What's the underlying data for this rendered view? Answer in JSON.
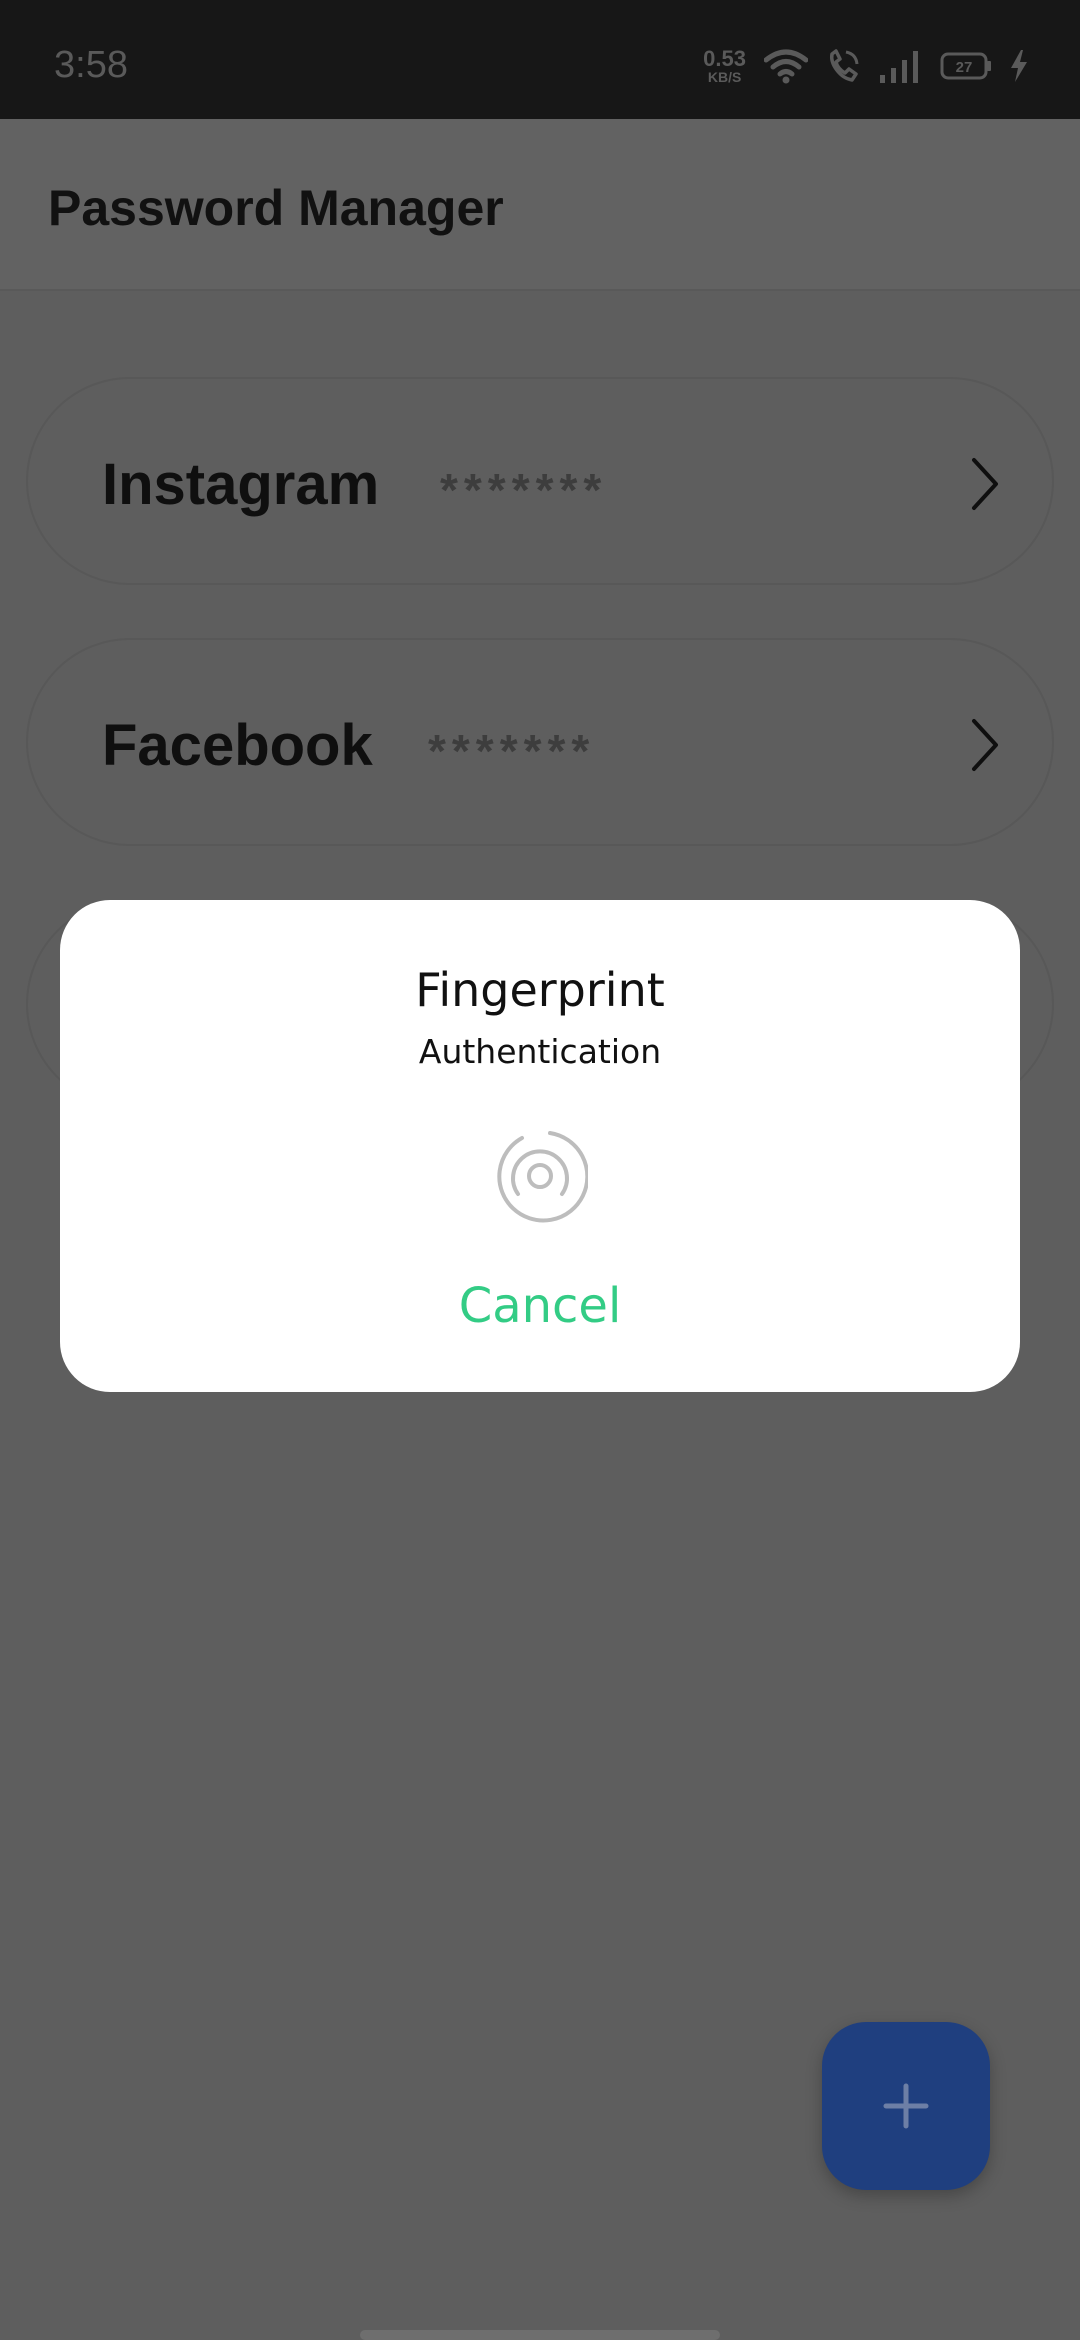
{
  "status_bar": {
    "time": "3:58",
    "net_speed_value": "0.53",
    "net_speed_unit": "KB/S",
    "battery_level": "27",
    "icons": [
      "wifi-icon",
      "volte-call-icon",
      "signal-icon",
      "battery-icon",
      "charging-icon"
    ]
  },
  "app_bar": {
    "title": "Password Manager"
  },
  "passwords": [
    {
      "name": "Instagram",
      "mask": "*******"
    },
    {
      "name": "Facebook",
      "mask": "*******"
    }
  ],
  "dialog": {
    "title": "Fingerprint",
    "subtitle": "Authentication",
    "icon": "fingerprint-icon",
    "cancel_label": "Cancel"
  },
  "fab": {
    "icon": "plus-icon"
  },
  "colors": {
    "accent_green": "#33cc85",
    "fab_blue": "#1f3f7f",
    "scrim": "#5e5e5e",
    "status_bar": "#171717"
  }
}
